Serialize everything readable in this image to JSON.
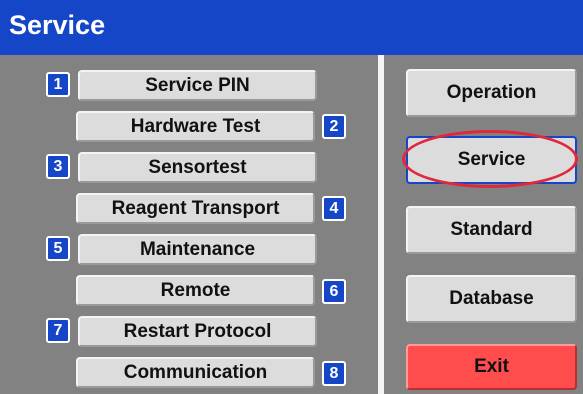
{
  "window": {
    "title": "Service"
  },
  "menu": {
    "items": [
      {
        "number": "1",
        "label": "Service PIN"
      },
      {
        "number": "2",
        "label": "Hardware Test"
      },
      {
        "number": "3",
        "label": "Sensortest"
      },
      {
        "number": "4",
        "label": "Reagent Transport"
      },
      {
        "number": "5",
        "label": "Maintenance"
      },
      {
        "number": "6",
        "label": "Remote"
      },
      {
        "number": "7",
        "label": "Restart Protocol"
      },
      {
        "number": "8",
        "label": "Communication"
      }
    ]
  },
  "nav": {
    "operation": "Operation",
    "service": "Service",
    "standard": "Standard",
    "database": "Database",
    "exit": "Exit"
  },
  "colors": {
    "accent": "#1546c8",
    "panel": "#828282",
    "button": "#dcdcdc",
    "exit": "#ff4d4d",
    "highlight": "#e0283a"
  }
}
